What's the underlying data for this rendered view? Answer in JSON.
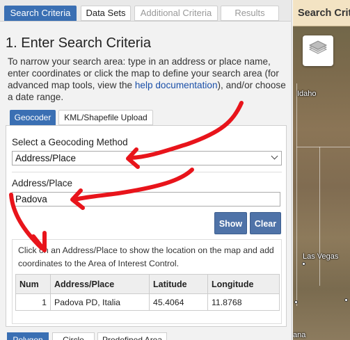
{
  "tabs": [
    "Search Criteria",
    "Data Sets",
    "Additional Criteria",
    "Results"
  ],
  "section": {
    "title": "1. Enter Search Criteria",
    "intro_before_link": "To narrow your search area: type in an address or place name, enter coordinates or click the map to define your search area (for advanced map tools, view the ",
    "intro_link": "help documentation",
    "intro_after_link": "), and/or choose a date range."
  },
  "subtabs": [
    "Geocoder",
    "KML/Shapefile Upload"
  ],
  "geocoder": {
    "method_label": "Select a Geocoding Method",
    "method_value": "Address/Place",
    "address_label": "Address/Place",
    "address_value": "Padova",
    "show_label": "Show",
    "clear_label": "Clear",
    "notice": "Click on an Address/Place to show the location on the map and add coordinates to the Area of Interest Control."
  },
  "results_table": {
    "headers": [
      "Num",
      "Address/Place",
      "Latitude",
      "Longitude"
    ],
    "rows": [
      {
        "num": "1",
        "place": "Padova PD, Italia",
        "lat": "45.4064",
        "lon": "11.8768"
      }
    ]
  },
  "bottom_tabs": [
    "Polygon",
    "Circle",
    "Predefined Area"
  ],
  "map": {
    "header": "Search Criteria",
    "labels": [
      "Idaho",
      "Las Vegas",
      "ana"
    ]
  },
  "colors": {
    "active_tab": "#3a6fb3",
    "button": "#4f73a8",
    "link": "#1a4fa8",
    "annotation": "#e8141b"
  }
}
